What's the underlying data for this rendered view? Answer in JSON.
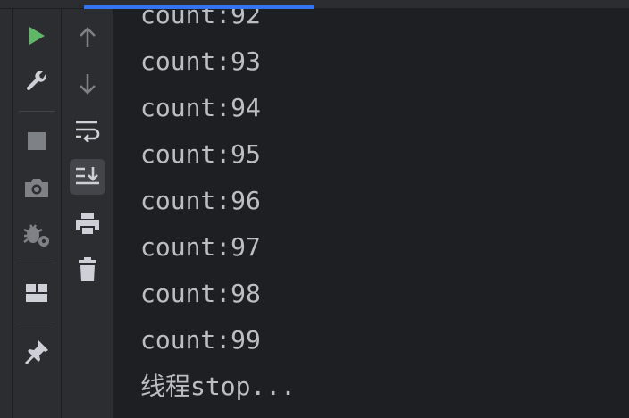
{
  "console": {
    "lines": [
      "count:92",
      "count:93",
      "count:94",
      "count:95",
      "count:96",
      "count:97",
      "count:98",
      "count:99",
      "线程stop..."
    ]
  },
  "colors": {
    "run_green": "#5fb865",
    "icon_gray": "#cdd0d6",
    "icon_dim": "#7e8186",
    "console_text": "#bcbec4",
    "scroll_accent": "#3574f0"
  },
  "icons": {
    "toolbar_primary": [
      "run-icon",
      "wrench-icon",
      "stop-icon",
      "camera-icon",
      "debug-settings-icon",
      "layout-icon",
      "pin-icon"
    ],
    "toolbar_secondary": [
      "arrow-up-icon",
      "arrow-down-icon",
      "soft-wrap-icon",
      "scroll-to-end-icon",
      "print-icon",
      "trash-icon"
    ]
  }
}
